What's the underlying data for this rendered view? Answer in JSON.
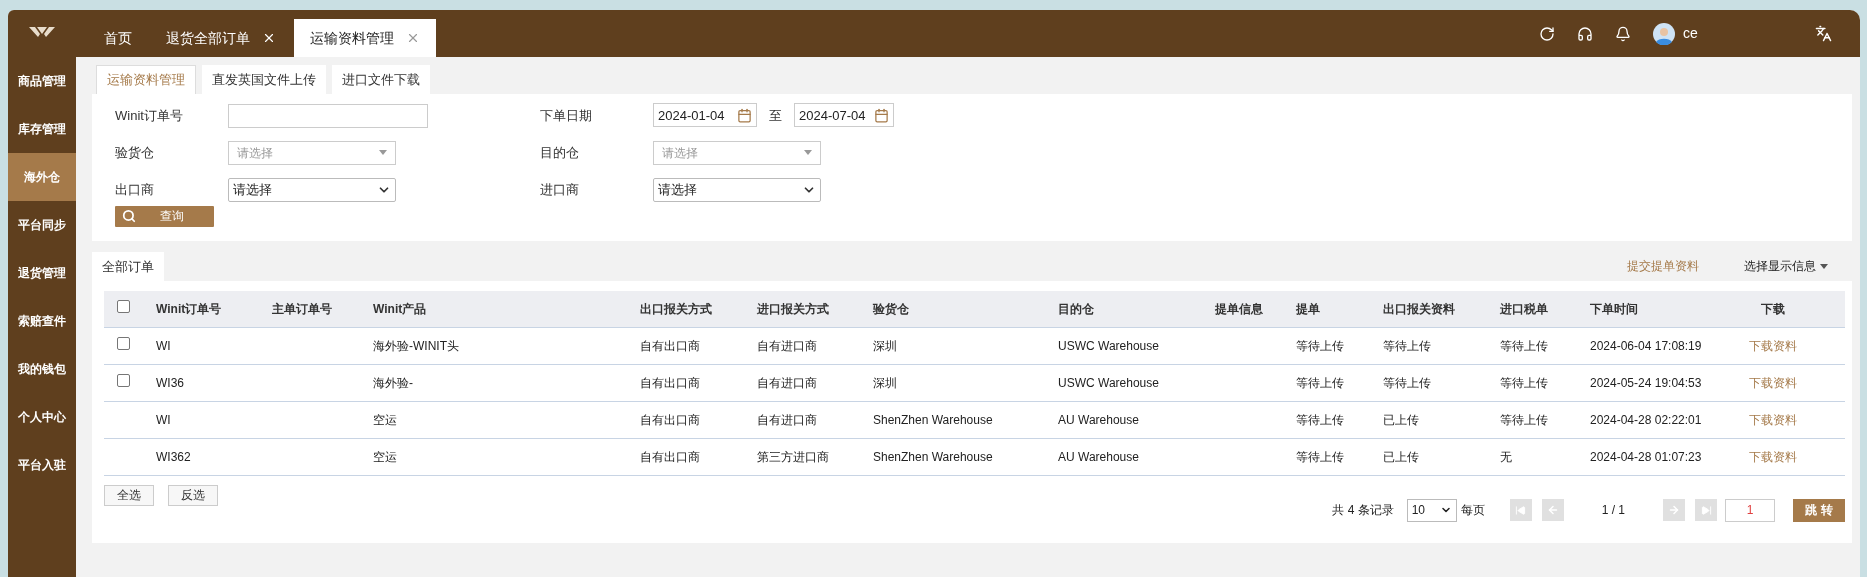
{
  "tabs": [
    {
      "label": "首页",
      "selected": false,
      "closable": false
    },
    {
      "label": "退货全部订单",
      "selected": false,
      "closable": true
    },
    {
      "label": "运输资料管理",
      "selected": true,
      "closable": true
    }
  ],
  "user": {
    "name": "ce"
  },
  "sidebar": {
    "items": [
      {
        "label": "商品管理",
        "selected": false
      },
      {
        "label": "库存管理",
        "selected": false
      },
      {
        "label": "海外仓",
        "selected": true
      },
      {
        "label": "平台同步",
        "selected": false
      },
      {
        "label": "退货管理",
        "selected": false
      },
      {
        "label": "索赔查件",
        "selected": false
      },
      {
        "label": "我的钱包",
        "selected": false
      },
      {
        "label": "个人中心",
        "selected": false
      },
      {
        "label": "平台入驻",
        "selected": false
      }
    ]
  },
  "sub_tabs": [
    {
      "label": "运输资料管理",
      "selected": true
    },
    {
      "label": "直发英国文件上传",
      "selected": false
    },
    {
      "label": "进口文件下载",
      "selected": false
    }
  ],
  "filters": [
    [
      {
        "label": "Winit订单号",
        "kind": "text"
      },
      {
        "label": "下单日期",
        "kind": "date_range",
        "from": "2024-01-04",
        "separator": "至",
        "to": "2024-07-04"
      }
    ],
    [
      {
        "label": "验货仓",
        "kind": "combo",
        "placeholder": "请选择"
      },
      {
        "label": "目的仓",
        "kind": "combo",
        "placeholder": "请选择"
      }
    ],
    [
      {
        "label": "出口商",
        "kind": "select",
        "value": "请选择"
      },
      {
        "label": "进口商",
        "kind": "select",
        "value": "请选择"
      }
    ]
  ],
  "query_button": "查询",
  "list_tab": "全部订单",
  "actions": {
    "submit": "提交提单资料",
    "display": "选择显示信息"
  },
  "table": {
    "columns": [
      "Winit订单号",
      "主单订单号",
      "Winit产品",
      "出口报关方式",
      "进口报关方式",
      "验货仓",
      "目的仓",
      "提单信息",
      "提单",
      "出口报关资料",
      "进口税单",
      "下单时间",
      "下载"
    ],
    "header_checked": false,
    "rows": [
      {
        "kind": "checkable",
        "checked": false,
        "cells": [
          "WI",
          "",
          "海外验-WINIT头",
          "自有出口商",
          "自有进口商",
          "深圳",
          "USWC Warehouse",
          "",
          "等待上传",
          "等待上传",
          "等待上传",
          "2024-06-04 17:08:19"
        ],
        "link": "下载资料"
      },
      {
        "kind": "checkable",
        "checked": false,
        "cells": [
          "WI36",
          "",
          "海外验-",
          "自有出口商",
          "自有进口商",
          "深圳",
          "USWC Warehouse",
          "",
          "等待上传",
          "等待上传",
          "等待上传",
          "2024-05-24 19:04:53"
        ],
        "link": "下载资料"
      },
      {
        "kind": "plain",
        "cells": [
          "WI",
          "",
          "空运",
          "自有出口商",
          "自有进口商",
          "ShenZhen Warehouse",
          "AU Warehouse",
          "",
          "等待上传",
          "已上传",
          "等待上传",
          "2024-04-28 02:22:01"
        ],
        "link": "下载资料"
      },
      {
        "kind": "plain",
        "cells": [
          "WI362",
          "",
          "空运",
          "自有出口商",
          "第三方进口商",
          "ShenZhen Warehouse",
          "AU Warehouse",
          "",
          "等待上传",
          "已上传",
          "无",
          "2024-04-28 01:07:23"
        ],
        "link": "下载资料"
      }
    ]
  },
  "bulk_buttons": [
    "全选",
    "反选"
  ],
  "pagination": {
    "total": "共 4 条记录",
    "page_size": "10",
    "per_page": "每页",
    "page_info": "1 / 1",
    "page_input": "1",
    "go": "跳 转"
  }
}
